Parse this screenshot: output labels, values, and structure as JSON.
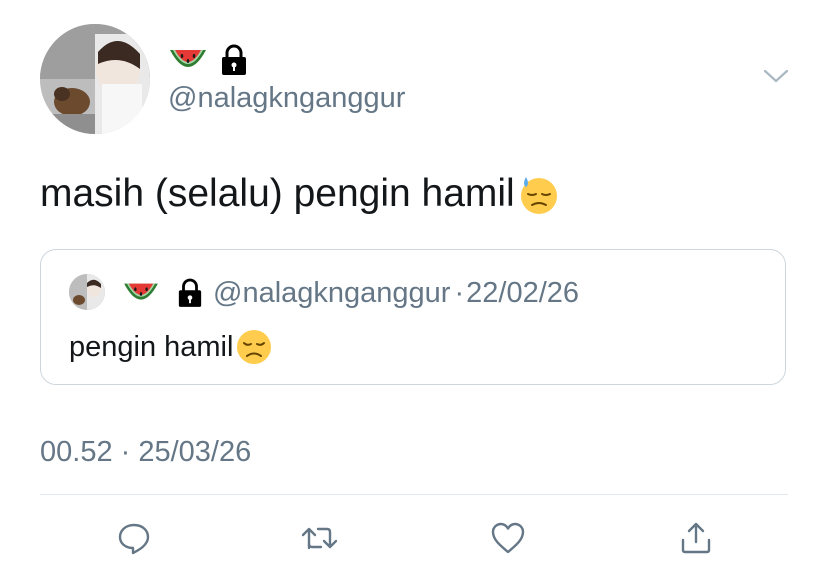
{
  "user": {
    "handle": "@nalagknganggur",
    "name_emojis": [
      "watermelon-icon",
      "lock-icon"
    ]
  },
  "tweet": {
    "text": "masih (selalu) pengin hamil",
    "emoji": "downcast-face-with-sweat-icon"
  },
  "quoted_tweet": {
    "handle": "@nalagknganggur",
    "separator": "·",
    "date": "22/02/26",
    "text": "pengin hamil",
    "emoji": "disappointed-face-icon"
  },
  "meta": {
    "timestamp": "00.52 · 25/03/26"
  },
  "actions": [
    "reply-icon",
    "retweet-icon",
    "like-icon",
    "share-icon"
  ],
  "colors": {
    "text": "#14171a",
    "secondary": "#657786",
    "border": "#ccd6dd",
    "icon": "#657786"
  }
}
